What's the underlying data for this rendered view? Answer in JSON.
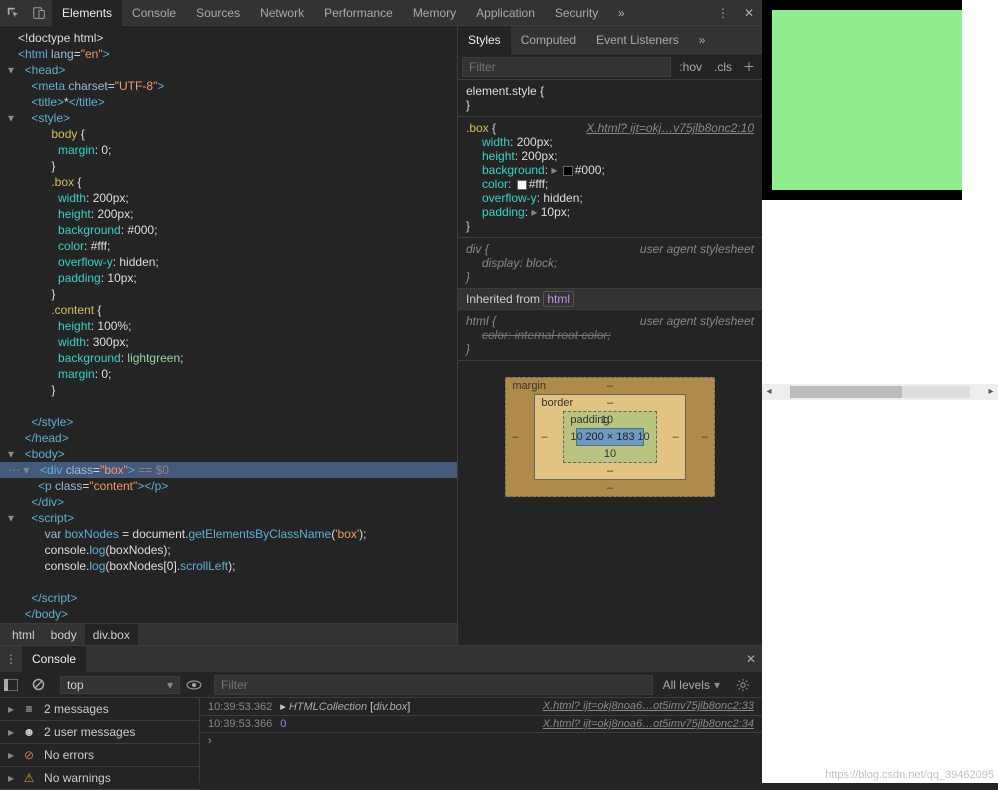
{
  "top_tabs": [
    "Elements",
    "Console",
    "Sources",
    "Network",
    "Performance",
    "Memory",
    "Application",
    "Security"
  ],
  "top_active": 0,
  "dom_lines": [
    {
      "indent": 0,
      "caret": "",
      "h": [
        [
          "white",
          "<!doctype html>"
        ]
      ]
    },
    {
      "indent": 0,
      "caret": "",
      "h": [
        [
          "tag",
          "<html "
        ],
        [
          "attr",
          "lang"
        ],
        [
          "white",
          "="
        ],
        [
          "val",
          "\"en\""
        ],
        [
          "tag",
          ">"
        ]
      ]
    },
    {
      "indent": 1,
      "caret": "▾",
      "h": [
        [
          "tag",
          "<head>"
        ]
      ]
    },
    {
      "indent": 2,
      "caret": "",
      "h": [
        [
          "tag",
          "<meta "
        ],
        [
          "attr",
          "charset"
        ],
        [
          "white",
          "="
        ],
        [
          "val",
          "\"UTF-8\""
        ],
        [
          "tag",
          ">"
        ]
      ]
    },
    {
      "indent": 2,
      "caret": "",
      "h": [
        [
          "tag",
          "<title>"
        ],
        [
          "white",
          "*"
        ],
        [
          "tag",
          "</title>"
        ]
      ]
    },
    {
      "indent": 2,
      "caret": "▾",
      "h": [
        [
          "tag",
          "<style>"
        ]
      ]
    },
    {
      "indent": 5,
      "caret": "",
      "h": [
        [
          "sel",
          "body "
        ],
        [
          "white",
          "{"
        ]
      ]
    },
    {
      "indent": 6,
      "caret": "",
      "h": [
        [
          "prop",
          "margin"
        ],
        [
          "white",
          ": "
        ],
        [
          "white",
          "0;"
        ]
      ]
    },
    {
      "indent": 5,
      "caret": "",
      "h": [
        [
          "white",
          "}"
        ]
      ]
    },
    {
      "indent": 5,
      "caret": "",
      "h": [
        [
          "sel",
          ".box "
        ],
        [
          "white",
          "{"
        ]
      ]
    },
    {
      "indent": 6,
      "caret": "",
      "h": [
        [
          "prop",
          "width"
        ],
        [
          "white",
          ": "
        ],
        [
          "white",
          "200px;"
        ]
      ]
    },
    {
      "indent": 6,
      "caret": "",
      "h": [
        [
          "prop",
          "height"
        ],
        [
          "white",
          ": "
        ],
        [
          "white",
          "200px;"
        ]
      ]
    },
    {
      "indent": 6,
      "caret": "",
      "h": [
        [
          "prop",
          "background"
        ],
        [
          "white",
          ": "
        ],
        [
          "white",
          "#000;"
        ]
      ]
    },
    {
      "indent": 6,
      "caret": "",
      "h": [
        [
          "prop",
          "color"
        ],
        [
          "white",
          ": "
        ],
        [
          "white",
          "#fff;"
        ]
      ]
    },
    {
      "indent": 6,
      "caret": "",
      "h": [
        [
          "prop",
          "overflow-y"
        ],
        [
          "white",
          ": "
        ],
        [
          "white",
          "hidden;"
        ]
      ]
    },
    {
      "indent": 6,
      "caret": "",
      "h": [
        [
          "prop",
          "padding"
        ],
        [
          "white",
          ": "
        ],
        [
          "white",
          "10px;"
        ]
      ]
    },
    {
      "indent": 5,
      "caret": "",
      "h": [
        [
          "white",
          "}"
        ]
      ]
    },
    {
      "indent": 5,
      "caret": "",
      "h": [
        [
          "sel",
          ".content "
        ],
        [
          "white",
          "{"
        ]
      ]
    },
    {
      "indent": 6,
      "caret": "",
      "h": [
        [
          "prop",
          "height"
        ],
        [
          "white",
          ": "
        ],
        [
          "white",
          "100%;"
        ]
      ]
    },
    {
      "indent": 6,
      "caret": "",
      "h": [
        [
          "prop",
          "width"
        ],
        [
          "white",
          ": "
        ],
        [
          "white",
          "300px;"
        ]
      ]
    },
    {
      "indent": 6,
      "caret": "",
      "h": [
        [
          "prop",
          "background"
        ],
        [
          "white",
          ": "
        ],
        [
          "lightgreen",
          "lightgreen"
        ],
        [
          "white",
          ";"
        ]
      ]
    },
    {
      "indent": 6,
      "caret": "",
      "h": [
        [
          "prop",
          "margin"
        ],
        [
          "white",
          ": "
        ],
        [
          "white",
          "0;"
        ]
      ]
    },
    {
      "indent": 5,
      "caret": "",
      "h": [
        [
          "white",
          "}"
        ]
      ]
    },
    {
      "indent": 0,
      "caret": "",
      "h": [
        [
          "white",
          ""
        ]
      ]
    },
    {
      "indent": 2,
      "caret": "",
      "h": [
        [
          "tag",
          "</style>"
        ]
      ]
    },
    {
      "indent": 1,
      "caret": "",
      "h": [
        [
          "tag",
          "</head>"
        ]
      ]
    },
    {
      "indent": 1,
      "caret": "▾",
      "h": [
        [
          "tag",
          "<body>"
        ]
      ]
    },
    {
      "indent": 1,
      "caret": "▾",
      "selected": true,
      "dots": true,
      "h": [
        [
          "tag",
          "<div "
        ],
        [
          "attr",
          "class"
        ],
        [
          "white",
          "="
        ],
        [
          "val",
          "\"box\""
        ],
        [
          "tag",
          ">"
        ],
        [
          "grey",
          " == $0"
        ]
      ]
    },
    {
      "indent": 3,
      "caret": "",
      "h": [
        [
          "tag",
          "<p "
        ],
        [
          "attr",
          "class"
        ],
        [
          "white",
          "="
        ],
        [
          "val",
          "\"content\""
        ],
        [
          "tag",
          "></p>"
        ]
      ]
    },
    {
      "indent": 2,
      "caret": "",
      "h": [
        [
          "tag",
          "</div>"
        ]
      ]
    },
    {
      "indent": 2,
      "caret": "▾",
      "h": [
        [
          "tag",
          "<script>"
        ]
      ]
    },
    {
      "indent": 4,
      "caret": "",
      "h": [
        [
          "keyword",
          "var "
        ],
        [
          "var",
          "boxNodes"
        ],
        [
          "white",
          " = document."
        ],
        [
          "func",
          "getElementsByClassName"
        ],
        [
          "white",
          "("
        ],
        [
          "str",
          "'box'"
        ],
        [
          "white",
          ");"
        ]
      ]
    },
    {
      "indent": 4,
      "caret": "",
      "h": [
        [
          "white",
          "console."
        ],
        [
          "func",
          "log"
        ],
        [
          "white",
          "(boxNodes);"
        ]
      ]
    },
    {
      "indent": 4,
      "caret": "",
      "h": [
        [
          "white",
          "console."
        ],
        [
          "func",
          "log"
        ],
        [
          "white",
          "(boxNodes["
        ],
        [
          "white",
          "0"
        ],
        [
          "white",
          "]."
        ],
        [
          "var",
          "scrollLeft"
        ],
        [
          "white",
          ");"
        ]
      ]
    },
    {
      "indent": 0,
      "caret": "",
      "h": [
        [
          "white",
          ""
        ]
      ]
    },
    {
      "indent": 2,
      "caret": "",
      "h": [
        [
          "tag",
          "</script>"
        ]
      ]
    },
    {
      "indent": 1,
      "caret": "",
      "h": [
        [
          "tag",
          "</body>"
        ]
      ]
    },
    {
      "indent": 0,
      "caret": "",
      "h": [
        [
          "tag",
          "</html>"
        ]
      ]
    }
  ],
  "breadcrumbs": [
    "html",
    "body",
    "div.box"
  ],
  "breadcrumb_active": 2,
  "styles_tabs": [
    "Styles",
    "Computed",
    "Event Listeners"
  ],
  "styles_active": 0,
  "styles_filter_placeholder": "Filter",
  "hov": ":hov",
  "cls": ".cls",
  "element_style_selector": "element.style",
  "box_rule": {
    "selector": ".box",
    "link": "X.html? ijt=okj…v75jlb8onc2:10",
    "props": [
      {
        "name": "width",
        "value": "200px"
      },
      {
        "name": "height",
        "value": "200px"
      },
      {
        "name": "background",
        "value": "#000",
        "swatch": "#000",
        "prefix": "▸"
      },
      {
        "name": "color",
        "value": "#fff",
        "swatch": "#fff",
        "prefix": ""
      },
      {
        "name": "overflow-y",
        "value": "hidden"
      },
      {
        "name": "padding",
        "value": "10px",
        "prefix": "▸"
      }
    ]
  },
  "div_rule": {
    "selector": "div",
    "ua": "user agent stylesheet",
    "props": [
      {
        "name": "display",
        "value": "block"
      }
    ]
  },
  "inherited_from": "html",
  "html_rule": {
    "selector": "html",
    "ua": "user agent stylesheet",
    "strike": "color:  internal root color;"
  },
  "box_model": {
    "margin": {
      "label": "margin",
      "top": "–",
      "right": "–",
      "bottom": "–",
      "left": "–"
    },
    "border": {
      "label": "border",
      "top": "–",
      "right": "–",
      "bottom": "–",
      "left": "–"
    },
    "padding": {
      "label": "padding",
      "top": "10",
      "right": "10",
      "bottom": "10",
      "left": "10"
    },
    "content": "200 × 183"
  },
  "console_tab": "Console",
  "console_context": "top",
  "console_filter_placeholder": "Filter",
  "console_levels": "All levels",
  "sidebar_items": [
    {
      "icon": "list",
      "label": "2 messages"
    },
    {
      "icon": "user",
      "label": "2 user messages"
    },
    {
      "icon": "error",
      "label": "No errors"
    },
    {
      "icon": "warn",
      "label": "No warnings"
    }
  ],
  "console_messages": [
    {
      "ts": "10:39:53.362",
      "body": [
        [
          "white",
          "▸ "
        ],
        [
          "italic",
          "HTMLCollection "
        ],
        [
          "white",
          "["
        ],
        [
          "italic",
          "div.box"
        ],
        [
          "white",
          "]"
        ]
      ],
      "link": "X.html? ijt=okj8noa6…ot5imv75jlb8onc2:33"
    },
    {
      "ts": "10:39:53.366",
      "body": [
        [
          "num",
          "0"
        ]
      ],
      "link": "X.html? ijt=okj8noa6…ot5imv75jlb8onc2:34"
    }
  ],
  "prompt": "›",
  "watermark": "https://blog.csdn.net/qq_39462095"
}
